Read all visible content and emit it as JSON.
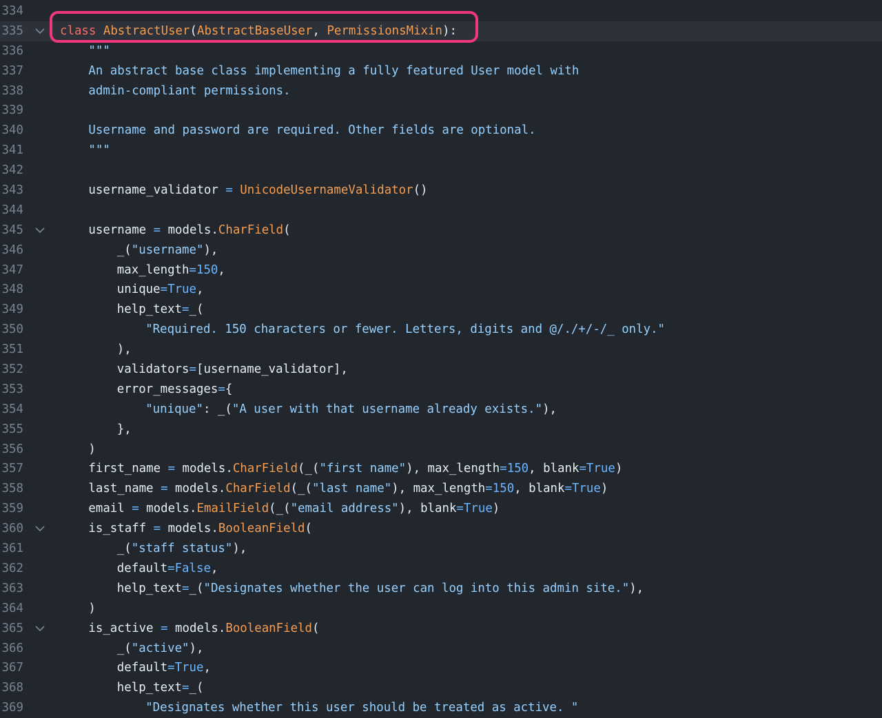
{
  "colors": {
    "background": "#22272e",
    "line_number": "#768390",
    "keyword": "#f47067",
    "class_name": "#f69d50",
    "string": "#96d0ff",
    "constant": "#6cb6ff",
    "plain": "#e6edf3",
    "highlight_box": "#f0377d"
  },
  "icons": {
    "fold": "chevron-down-icon"
  },
  "lines": [
    {
      "n": "334"
    },
    {
      "n": "335",
      "fold": true,
      "current": true,
      "highlighted": true,
      "tokens": [
        {
          "t": "kw",
          "v": "class"
        },
        {
          "t": "plain",
          "v": " "
        },
        {
          "t": "fn",
          "v": "AbstractUser"
        },
        {
          "t": "plain",
          "v": "("
        },
        {
          "t": "fn",
          "v": "AbstractBaseUser"
        },
        {
          "t": "plain",
          "v": ", "
        },
        {
          "t": "fn",
          "v": "PermissionsMixin"
        },
        {
          "t": "plain",
          "v": "):"
        }
      ]
    },
    {
      "n": "336",
      "ind": 1,
      "tokens": [
        {
          "t": "str",
          "v": "\"\"\""
        }
      ]
    },
    {
      "n": "337",
      "ind": 1,
      "tokens": [
        {
          "t": "str",
          "v": "An abstract base class implementing a fully featured User model with"
        }
      ]
    },
    {
      "n": "338",
      "ind": 1,
      "tokens": [
        {
          "t": "str",
          "v": "admin-compliant permissions."
        }
      ]
    },
    {
      "n": "339"
    },
    {
      "n": "340",
      "ind": 1,
      "tokens": [
        {
          "t": "str",
          "v": "Username and password are required. Other fields are optional."
        }
      ]
    },
    {
      "n": "341",
      "ind": 1,
      "tokens": [
        {
          "t": "str",
          "v": "\"\"\""
        }
      ]
    },
    {
      "n": "342"
    },
    {
      "n": "343",
      "ind": 1,
      "tokens": [
        {
          "t": "plain",
          "v": "username_validator "
        },
        {
          "t": "op",
          "v": "="
        },
        {
          "t": "plain",
          "v": " "
        },
        {
          "t": "fn",
          "v": "UnicodeUsernameValidator"
        },
        {
          "t": "plain",
          "v": "()"
        }
      ]
    },
    {
      "n": "344"
    },
    {
      "n": "345",
      "ind": 1,
      "fold": true,
      "tokens": [
        {
          "t": "plain",
          "v": "username "
        },
        {
          "t": "op",
          "v": "="
        },
        {
          "t": "plain",
          "v": " models."
        },
        {
          "t": "fn",
          "v": "CharField"
        },
        {
          "t": "plain",
          "v": "("
        }
      ]
    },
    {
      "n": "346",
      "ind": 2,
      "tokens": [
        {
          "t": "plain",
          "v": "_("
        },
        {
          "t": "str",
          "v": "\"username\""
        },
        {
          "t": "plain",
          "v": "),"
        }
      ]
    },
    {
      "n": "347",
      "ind": 2,
      "tokens": [
        {
          "t": "plain",
          "v": "max_length"
        },
        {
          "t": "op",
          "v": "="
        },
        {
          "t": "const",
          "v": "150"
        },
        {
          "t": "plain",
          "v": ","
        }
      ]
    },
    {
      "n": "348",
      "ind": 2,
      "tokens": [
        {
          "t": "plain",
          "v": "unique"
        },
        {
          "t": "op",
          "v": "="
        },
        {
          "t": "const",
          "v": "True"
        },
        {
          "t": "plain",
          "v": ","
        }
      ]
    },
    {
      "n": "349",
      "ind": 2,
      "tokens": [
        {
          "t": "plain",
          "v": "help_text"
        },
        {
          "t": "op",
          "v": "="
        },
        {
          "t": "plain",
          "v": "_("
        }
      ]
    },
    {
      "n": "350",
      "ind": 3,
      "tokens": [
        {
          "t": "str",
          "v": "\"Required. 150 characters or fewer. Letters, digits and @/./+/-/_ only.\""
        }
      ]
    },
    {
      "n": "351",
      "ind": 2,
      "tokens": [
        {
          "t": "plain",
          "v": "),"
        }
      ]
    },
    {
      "n": "352",
      "ind": 2,
      "tokens": [
        {
          "t": "plain",
          "v": "validators"
        },
        {
          "t": "op",
          "v": "="
        },
        {
          "t": "plain",
          "v": "[username_validator],"
        }
      ]
    },
    {
      "n": "353",
      "ind": 2,
      "tokens": [
        {
          "t": "plain",
          "v": "error_messages"
        },
        {
          "t": "op",
          "v": "="
        },
        {
          "t": "plain",
          "v": "{"
        }
      ]
    },
    {
      "n": "354",
      "ind": 3,
      "tokens": [
        {
          "t": "str",
          "v": "\"unique\""
        },
        {
          "t": "plain",
          "v": ": _("
        },
        {
          "t": "str",
          "v": "\"A user with that username already exists.\""
        },
        {
          "t": "plain",
          "v": "),"
        }
      ]
    },
    {
      "n": "355",
      "ind": 2,
      "tokens": [
        {
          "t": "plain",
          "v": "},"
        }
      ]
    },
    {
      "n": "356",
      "ind": 1,
      "tokens": [
        {
          "t": "plain",
          "v": ")"
        }
      ]
    },
    {
      "n": "357",
      "ind": 1,
      "tokens": [
        {
          "t": "plain",
          "v": "first_name "
        },
        {
          "t": "op",
          "v": "="
        },
        {
          "t": "plain",
          "v": " models."
        },
        {
          "t": "fn",
          "v": "CharField"
        },
        {
          "t": "plain",
          "v": "(_("
        },
        {
          "t": "str",
          "v": "\"first name\""
        },
        {
          "t": "plain",
          "v": "), max_length"
        },
        {
          "t": "op",
          "v": "="
        },
        {
          "t": "const",
          "v": "150"
        },
        {
          "t": "plain",
          "v": ", blank"
        },
        {
          "t": "op",
          "v": "="
        },
        {
          "t": "const",
          "v": "True"
        },
        {
          "t": "plain",
          "v": ")"
        }
      ]
    },
    {
      "n": "358",
      "ind": 1,
      "tokens": [
        {
          "t": "plain",
          "v": "last_name "
        },
        {
          "t": "op",
          "v": "="
        },
        {
          "t": "plain",
          "v": " models."
        },
        {
          "t": "fn",
          "v": "CharField"
        },
        {
          "t": "plain",
          "v": "(_("
        },
        {
          "t": "str",
          "v": "\"last name\""
        },
        {
          "t": "plain",
          "v": "), max_length"
        },
        {
          "t": "op",
          "v": "="
        },
        {
          "t": "const",
          "v": "150"
        },
        {
          "t": "plain",
          "v": ", blank"
        },
        {
          "t": "op",
          "v": "="
        },
        {
          "t": "const",
          "v": "True"
        },
        {
          "t": "plain",
          "v": ")"
        }
      ]
    },
    {
      "n": "359",
      "ind": 1,
      "tokens": [
        {
          "t": "plain",
          "v": "email "
        },
        {
          "t": "op",
          "v": "="
        },
        {
          "t": "plain",
          "v": " models."
        },
        {
          "t": "fn",
          "v": "EmailField"
        },
        {
          "t": "plain",
          "v": "(_("
        },
        {
          "t": "str",
          "v": "\"email address\""
        },
        {
          "t": "plain",
          "v": "), blank"
        },
        {
          "t": "op",
          "v": "="
        },
        {
          "t": "const",
          "v": "True"
        },
        {
          "t": "plain",
          "v": ")"
        }
      ]
    },
    {
      "n": "360",
      "ind": 1,
      "fold": true,
      "tokens": [
        {
          "t": "plain",
          "v": "is_staff "
        },
        {
          "t": "op",
          "v": "="
        },
        {
          "t": "plain",
          "v": " models."
        },
        {
          "t": "fn",
          "v": "BooleanField"
        },
        {
          "t": "plain",
          "v": "("
        }
      ]
    },
    {
      "n": "361",
      "ind": 2,
      "tokens": [
        {
          "t": "plain",
          "v": "_("
        },
        {
          "t": "str",
          "v": "\"staff status\""
        },
        {
          "t": "plain",
          "v": "),"
        }
      ]
    },
    {
      "n": "362",
      "ind": 2,
      "tokens": [
        {
          "t": "plain",
          "v": "default"
        },
        {
          "t": "op",
          "v": "="
        },
        {
          "t": "const",
          "v": "False"
        },
        {
          "t": "plain",
          "v": ","
        }
      ]
    },
    {
      "n": "363",
      "ind": 2,
      "tokens": [
        {
          "t": "plain",
          "v": "help_text"
        },
        {
          "t": "op",
          "v": "="
        },
        {
          "t": "plain",
          "v": "_("
        },
        {
          "t": "str",
          "v": "\"Designates whether the user can log into this admin site.\""
        },
        {
          "t": "plain",
          "v": "),"
        }
      ]
    },
    {
      "n": "364",
      "ind": 1,
      "tokens": [
        {
          "t": "plain",
          "v": ")"
        }
      ]
    },
    {
      "n": "365",
      "ind": 1,
      "fold": true,
      "tokens": [
        {
          "t": "plain",
          "v": "is_active "
        },
        {
          "t": "op",
          "v": "="
        },
        {
          "t": "plain",
          "v": " models."
        },
        {
          "t": "fn",
          "v": "BooleanField"
        },
        {
          "t": "plain",
          "v": "("
        }
      ]
    },
    {
      "n": "366",
      "ind": 2,
      "tokens": [
        {
          "t": "plain",
          "v": "_("
        },
        {
          "t": "str",
          "v": "\"active\""
        },
        {
          "t": "plain",
          "v": "),"
        }
      ]
    },
    {
      "n": "367",
      "ind": 2,
      "tokens": [
        {
          "t": "plain",
          "v": "default"
        },
        {
          "t": "op",
          "v": "="
        },
        {
          "t": "const",
          "v": "True"
        },
        {
          "t": "plain",
          "v": ","
        }
      ]
    },
    {
      "n": "368",
      "ind": 2,
      "tokens": [
        {
          "t": "plain",
          "v": "help_text"
        },
        {
          "t": "op",
          "v": "="
        },
        {
          "t": "plain",
          "v": "_("
        }
      ]
    },
    {
      "n": "369",
      "ind": 3,
      "tokens": [
        {
          "t": "str",
          "v": "\"Designates whether this user should be treated as active. \""
        }
      ]
    }
  ]
}
